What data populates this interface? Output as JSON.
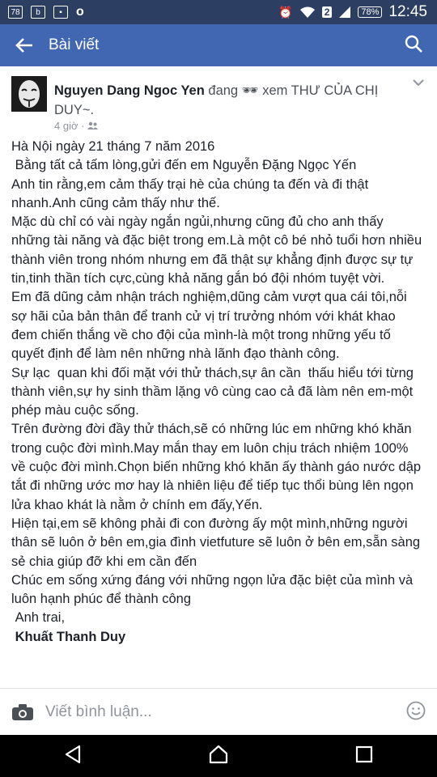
{
  "status_bar": {
    "time": "12:45",
    "battery": "78%",
    "sim": "2",
    "left_icons": [
      "78",
      "b",
      "image",
      "o"
    ]
  },
  "app_bar": {
    "title": "Bài viết"
  },
  "post": {
    "author": "Nguyen Dang Ngoc Yen",
    "activity_prefix": " đang ",
    "activity_rest": " xem THƯ CỦA CHỊ DUY~.",
    "time": "4 giờ ·",
    "lines": [
      "Hà Nội ngày 21 tháng 7 năm 2016",
      " Bằng tất cả tấm lòng,gửi đến em Nguyễn Đặng Ngọc Yến",
      "Anh tin rằng,em cảm thấy trại hè của chúng ta đến và đi thật nhanh.Anh cũng cảm thấy như thế.",
      "Mặc dù chỉ có vài ngày ngắn ngủi,nhưng cũng đủ cho anh thấy những tài năng và đặc biệt trong em.Là một cô bé nhỏ tuổi hơn nhiều thành viên trong nhóm nhưng em đã thật sự khẳng định được sự tự tin,tinh thần tích cực,cùng khả năng gắn bó đội nhóm tuyệt vời.",
      "Em đã dũng cảm nhận trách nghiệm,dũng cảm vượt qua cái tôi,nỗi sợ hãi của bản thân để tranh cử vị trí trưởng nhóm với khát khao đem chiến thắng về cho đội của mình-là một trong những yếu tố quyết định để làm nên những nhà lãnh đạo thành công.",
      "Sự lạc  quan khi đối mặt với thử thách,sự ân cần  thấu hiểu tới từng thành viên,sự hy sinh thầm lặng vô cùng cao cả đã làm nên em-một phép màu cuộc sống.",
      "Trên đường đời đầy thử thách,sẽ có những lúc em những khó khăn trong cuộc đời mình.May mắn thay em luôn chịu trách nhiệm 100% về cuộc đời mình.Chọn biến những khó khăn ấy thành gáo nước dập tắt đi những ước mơ hay là nhiên liệu để tiếp tục thổi bùng lên ngọn lửa khao khát là nằm ở chính em đấy,Yến.",
      "Hiện tại,em sẽ không phải đi con đường ấy một mình,những người thân sẽ luôn ở bên em,gia đình vietfuture sẽ luôn ở bên em,sẵn sàng sẻ chia giúp đỡ khi em cần đến",
      "Chúc em sống xứng đáng với những ngọn lửa đặc biệt của mình và luôn hạnh phúc để thành công",
      " Anh trai,"
    ],
    "signature": " Khuất Thanh Duy"
  },
  "comment_bar": {
    "placeholder": "Viết bình luận..."
  },
  "colors": {
    "brand": "#4267b2",
    "status": "#2c3e62",
    "text": "#1d2129",
    "meta": "#90949c"
  },
  "icons": [
    "back-arrow-icon",
    "search-icon",
    "avatar",
    "sunglasses-emoji-icon",
    "friends-icon",
    "chevron-down-icon",
    "camera-icon",
    "smiley-icon",
    "nav-back-icon",
    "nav-home-icon",
    "nav-recents-icon"
  ]
}
